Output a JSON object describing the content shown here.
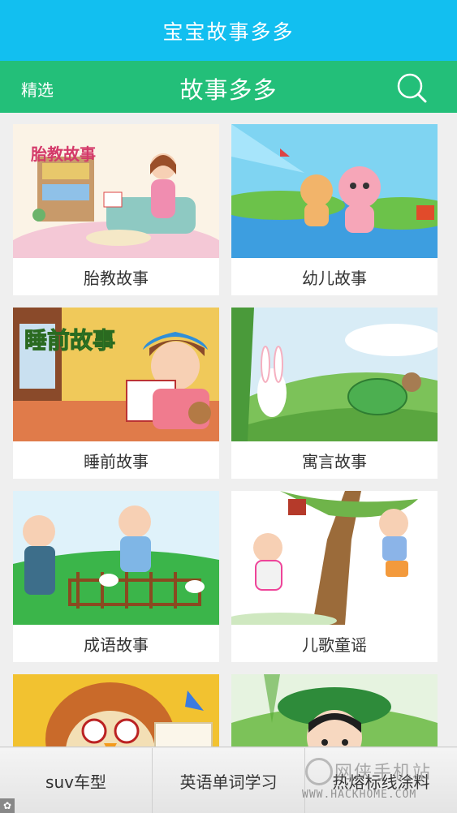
{
  "app": {
    "title": "宝宝故事多多"
  },
  "nav": {
    "left_label": "精选",
    "title": "故事多多",
    "search_icon": "search-icon"
  },
  "colors": {
    "title_bar": "#12bff0",
    "nav_bar": "#23bf79"
  },
  "categories": [
    {
      "label": "胎教故事",
      "art_text": "胎教故事"
    },
    {
      "label": "幼儿故事"
    },
    {
      "label": "睡前故事",
      "art_text": "睡前故事"
    },
    {
      "label": "寓言故事"
    },
    {
      "label": "成语故事"
    },
    {
      "label": "儿歌童谣"
    },
    {
      "label": ""
    },
    {
      "label": ""
    }
  ],
  "bottom_bar": {
    "items": [
      "suv车型",
      "英语单词学习",
      "热熔标线涂料"
    ]
  },
  "watermark": {
    "text": "网侠手机站",
    "url": "WWW.HACKHOME.COM"
  }
}
